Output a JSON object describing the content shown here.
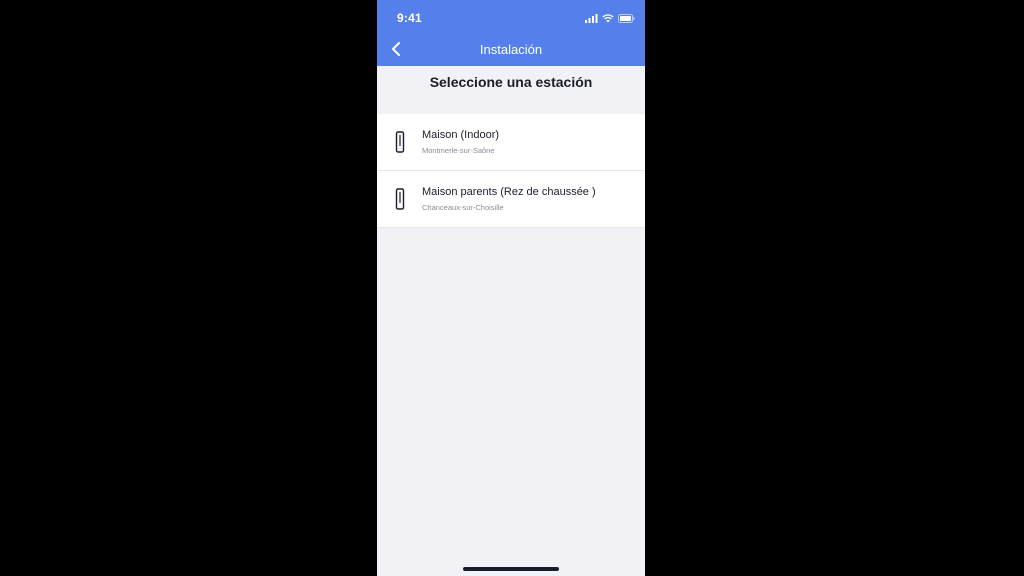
{
  "status_bar": {
    "time": "9:41",
    "icons": [
      "signal-icon",
      "wifi-icon",
      "battery-icon"
    ]
  },
  "nav": {
    "back_icon": "chevron-left-icon",
    "title": "Instalación"
  },
  "section": {
    "title": "Seleccione una estación"
  },
  "stations": [
    {
      "name": "Maison (Indoor)",
      "location": "Montmerle-sur-Saône",
      "icon": "station-device-icon"
    },
    {
      "name": "Maison parents (Rez de chaussée )",
      "location": "Chanceaux-sur-Choisille",
      "icon": "station-device-icon"
    }
  ],
  "colors": {
    "header": "#5580ec",
    "background": "#f2f2f6",
    "card": "#ffffff",
    "text": "#1b1d2a",
    "subtext": "#8a8c97"
  }
}
